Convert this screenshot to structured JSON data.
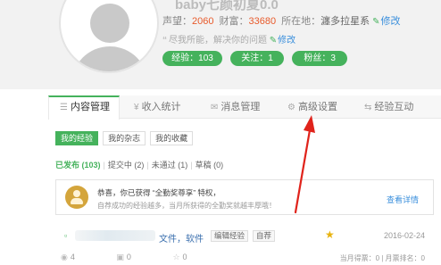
{
  "profile": {
    "username": "baby七颜初夏0.0",
    "stats": {
      "reputation_label": "声望：",
      "reputation_value": "2060",
      "wealth_label": "财富：",
      "wealth_value": "33680",
      "location_label": "所在地：",
      "location_value": "瀍多拉星系",
      "edit_label": "修改"
    },
    "motto": "尽我所能，解决你的问题",
    "motto_edit": "修改",
    "pills": {
      "experience": "经验：103",
      "following": "关注：1",
      "fans": "粉丝：3"
    }
  },
  "tabs": [
    {
      "label": "内容管理",
      "icon": "list-icon"
    },
    {
      "label": "收入统计",
      "icon": "yen-icon"
    },
    {
      "label": "消息管理",
      "icon": "mail-icon"
    },
    {
      "label": "高级设置",
      "icon": "gear-icon"
    },
    {
      "label": "经验互动",
      "icon": "swap-icon"
    }
  ],
  "subtabs": [
    "我的经验",
    "我的杂志",
    "我的收藏"
  ],
  "filter": {
    "published": "已发布 (103)",
    "submitting": "提交中 (2)",
    "rejected": "未通过 (1)",
    "draft": "草稿 (0)"
  },
  "notice": {
    "title": "恭喜，你已获得 “全勤奖尊享” 特权，",
    "subtitle": "自荐成功的经验越多，当月所获得的全勤奖就越丰厚哦！",
    "link": "查看详情"
  },
  "item": {
    "title": "文件，软件",
    "tags": [
      "编辑经验",
      "自荐"
    ],
    "date": "2016-02-24"
  },
  "meta": {
    "views": "4",
    "votes": "0",
    "favorites": "0",
    "rank": "当月得票：0 | 月票排名：0"
  },
  "colors": {
    "accent_green": "#45b25c",
    "link_blue": "#3a8fdc",
    "number_orange": "#e85a2b",
    "annotation_red": "#e0231b"
  }
}
